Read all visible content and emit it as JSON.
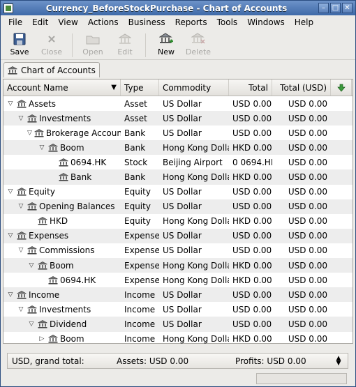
{
  "window": {
    "title": "Currency_BeforeStockPurchase - Chart of Accounts",
    "buttons": {
      "minimize": "–",
      "maximize": "□",
      "close": "✕"
    }
  },
  "menu": [
    {
      "label": "File"
    },
    {
      "label": "Edit"
    },
    {
      "label": "View"
    },
    {
      "label": "Actions"
    },
    {
      "label": "Business"
    },
    {
      "label": "Reports"
    },
    {
      "label": "Tools"
    },
    {
      "label": "Windows"
    },
    {
      "label": "Help"
    }
  ],
  "toolbar": {
    "save": "Save",
    "close": "Close",
    "open": "Open",
    "edit": "Edit",
    "new": "New",
    "delete": "Delete"
  },
  "tab": {
    "label": "Chart of Accounts"
  },
  "columns": {
    "name": "Account Name",
    "type": "Type",
    "commodity": "Commodity",
    "total": "Total",
    "total_usd": "Total (USD)"
  },
  "rows": [
    {
      "name": "Assets",
      "level": 0,
      "expander": "open",
      "type": "Asset",
      "commodity": "US Dollar",
      "total": "USD 0.00",
      "total_usd": "USD 0.00"
    },
    {
      "name": "Investments",
      "level": 1,
      "expander": "open",
      "type": "Asset",
      "commodity": "US Dollar",
      "total": "USD 0.00",
      "total_usd": "USD 0.00"
    },
    {
      "name": "Brokerage Account",
      "level": 2,
      "expander": "open",
      "type": "Bank",
      "commodity": "US Dollar",
      "total": "USD 0.00",
      "total_usd": "USD 0.00"
    },
    {
      "name": "Boom",
      "level": 3,
      "expander": "open",
      "type": "Bank",
      "commodity": "Hong Kong Dollar",
      "total": "HKD 0.00",
      "total_usd": "USD 0.00"
    },
    {
      "name": "0694.HK",
      "level": 4,
      "expander": "none",
      "type": "Stock",
      "commodity": "Beijing Airport",
      "total": "0 0694.HK",
      "total_usd": "USD 0.00"
    },
    {
      "name": "Bank",
      "level": 4,
      "expander": "none",
      "type": "Bank",
      "commodity": "Hong Kong Dollar",
      "total": "HKD 0.00",
      "total_usd": "USD 0.00"
    },
    {
      "name": "Equity",
      "level": 0,
      "expander": "open",
      "type": "Equity",
      "commodity": "US Dollar",
      "total": "USD 0.00",
      "total_usd": "USD 0.00"
    },
    {
      "name": "Opening Balances",
      "level": 1,
      "expander": "open",
      "type": "Equity",
      "commodity": "US Dollar",
      "total": "USD 0.00",
      "total_usd": "USD 0.00"
    },
    {
      "name": "HKD",
      "level": 2,
      "expander": "none",
      "type": "Equity",
      "commodity": "Hong Kong Dollar",
      "total": "HKD 0.00",
      "total_usd": "USD 0.00"
    },
    {
      "name": "Expenses",
      "level": 0,
      "expander": "open",
      "type": "Expense",
      "commodity": "US Dollar",
      "total": "USD 0.00",
      "total_usd": "USD 0.00"
    },
    {
      "name": "Commissions",
      "level": 1,
      "expander": "open",
      "type": "Expense",
      "commodity": "US Dollar",
      "total": "USD 0.00",
      "total_usd": "USD 0.00"
    },
    {
      "name": "Boom",
      "level": 2,
      "expander": "open",
      "type": "Expense",
      "commodity": "Hong Kong Dollar",
      "total": "HKD 0.00",
      "total_usd": "USD 0.00"
    },
    {
      "name": "0694.HK",
      "level": 3,
      "expander": "none",
      "type": "Expense",
      "commodity": "Hong Kong Dollar",
      "total": "HKD 0.00",
      "total_usd": "USD 0.00"
    },
    {
      "name": "Income",
      "level": 0,
      "expander": "open",
      "type": "Income",
      "commodity": "US Dollar",
      "total": "USD 0.00",
      "total_usd": "USD 0.00"
    },
    {
      "name": "Investments",
      "level": 1,
      "expander": "open",
      "type": "Income",
      "commodity": "US Dollar",
      "total": "USD 0.00",
      "total_usd": "USD 0.00"
    },
    {
      "name": "Dividend",
      "level": 2,
      "expander": "open",
      "type": "Income",
      "commodity": "US Dollar",
      "total": "USD 0.00",
      "total_usd": "USD 0.00"
    },
    {
      "name": "Boom",
      "level": 3,
      "expander": "closed",
      "type": "Income",
      "commodity": "Hong Kong Dollar",
      "total": "HKD 0.00",
      "total_usd": "USD 0.00"
    }
  ],
  "summary": {
    "label": "USD, grand total:",
    "assets": "Assets: USD 0.00",
    "profits": "Profits: USD 0.00"
  }
}
